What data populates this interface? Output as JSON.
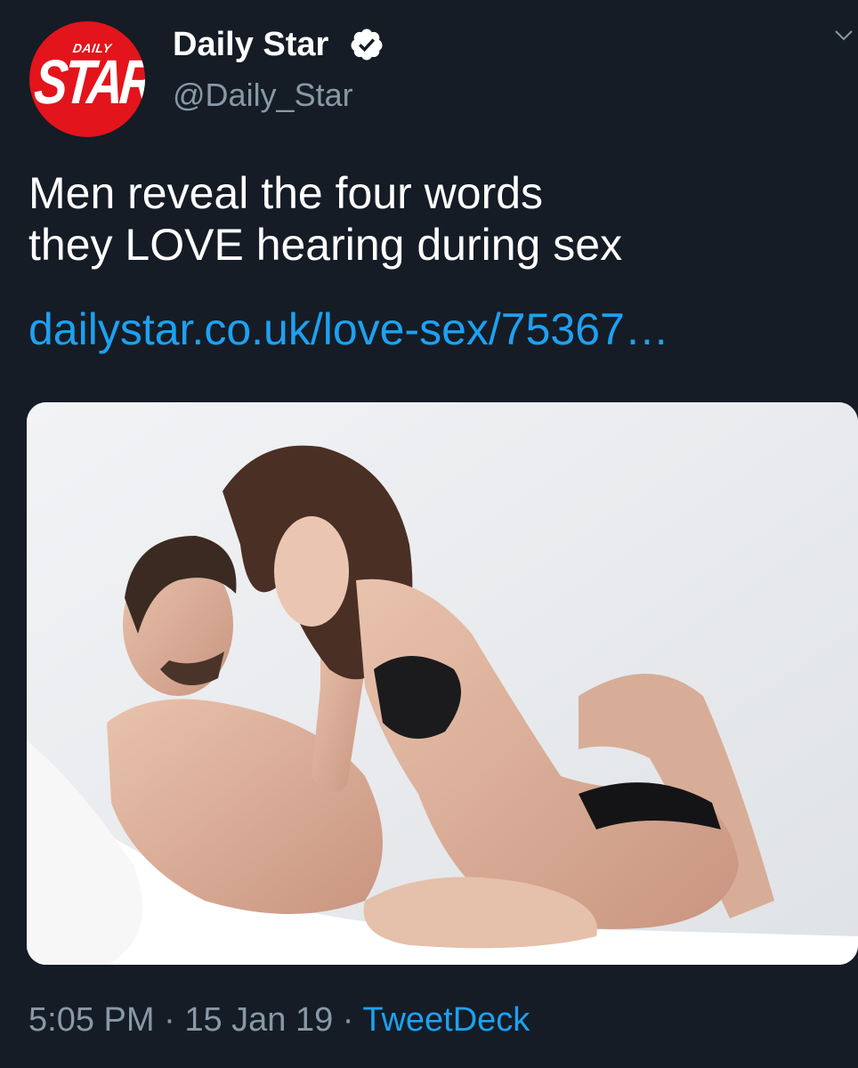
{
  "account": {
    "display_name": "Daily Star",
    "handle": "@Daily_Star",
    "avatar_logo_small": "DAILY",
    "avatar_logo_big": "STAR",
    "verified": true
  },
  "tweet": {
    "text_line_1": "Men reveal the four words",
    "text_line_2": "they LOVE hearing during sex",
    "link": "dailystar.co.uk/love-sex/75367…"
  },
  "meta": {
    "time": "5:05 PM",
    "separator_1": " · ",
    "date": "15 Jan 19",
    "separator_2": " · ",
    "source": "TweetDeck"
  },
  "colors": {
    "background": "#151c25",
    "text": "#ffffff",
    "secondary": "#8899a6",
    "link": "#1da1f2",
    "avatar_red": "#e3141b"
  },
  "icons": {
    "verified": "verified-badge-icon",
    "caret": "chevron-down-icon"
  }
}
